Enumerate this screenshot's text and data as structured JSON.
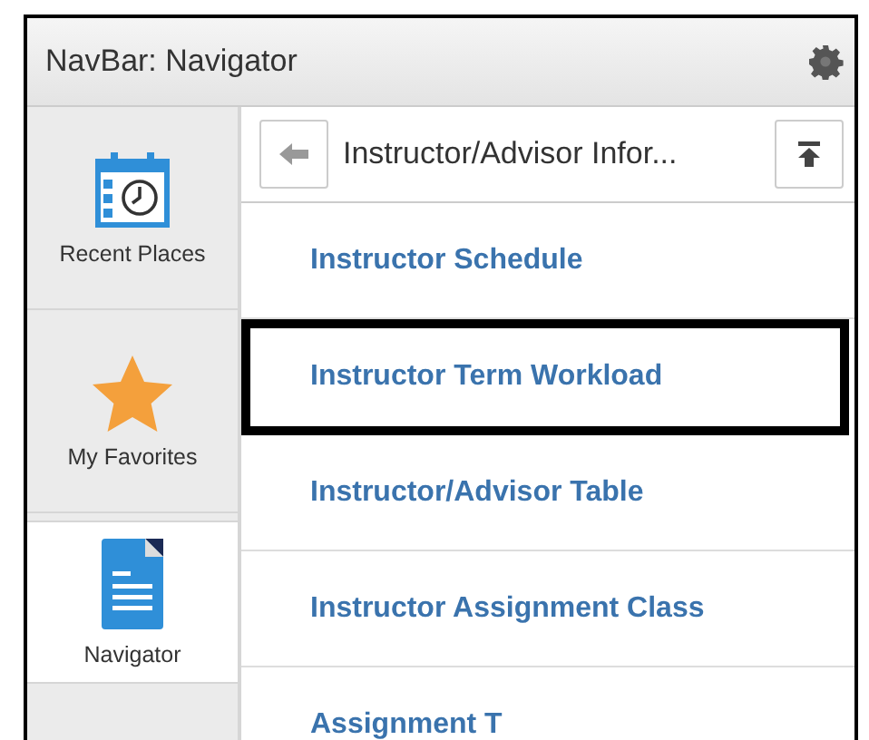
{
  "window": {
    "title": "NavBar: Navigator"
  },
  "sidebar": {
    "items": [
      {
        "label": "Recent Places",
        "kind": "recent",
        "selected": false
      },
      {
        "label": "My Favorites",
        "kind": "favorites",
        "selected": false
      },
      {
        "label": "Navigator",
        "kind": "navigator",
        "selected": true
      }
    ]
  },
  "breadcrumb": {
    "title": "Instructor/Advisor Infor..."
  },
  "items": [
    {
      "label": "Instructor Schedule",
      "selected": false
    },
    {
      "label": "Instructor Term Workload",
      "selected": true
    },
    {
      "label": "Instructor/Advisor Table",
      "selected": false
    },
    {
      "label": "Instructor Assignment Class",
      "selected": false
    },
    {
      "label": "Assignment T",
      "selected": false
    }
  ]
}
